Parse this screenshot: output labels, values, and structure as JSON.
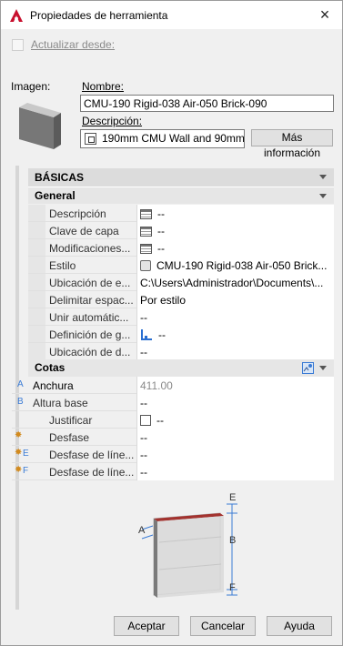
{
  "window": {
    "title": "Propiedades de herramienta"
  },
  "top": {
    "update_from_label": "Actualizar desde:",
    "update_from_checked": false,
    "image_label": "Imagen:",
    "name_label": "Nombre:",
    "name_value": "CMU-190 Rigid-038 Air-050 Brick-090",
    "description_label": "Descripción:",
    "description_value": "190mm CMU Wall and 90mm",
    "more_info_button": "Más información"
  },
  "basicas": {
    "header": "BÁSICAS",
    "general_header": "General",
    "rows": [
      {
        "label": "Descripción",
        "value": "--"
      },
      {
        "label": "Clave de capa",
        "value": "--"
      },
      {
        "label": "Modificaciones...",
        "value": "--"
      },
      {
        "label": "Estilo",
        "value": "CMU-190 Rigid-038 Air-050 Brick..."
      },
      {
        "label": "Ubicación de e...",
        "value": "C:\\Users\\Administrador\\Documents\\..."
      },
      {
        "label": "Delimitar espac...",
        "value": "Por estilo"
      },
      {
        "label": "Unir automátic...",
        "value": "--"
      },
      {
        "label": "Definición de g...",
        "value": "--"
      },
      {
        "label": "Ubicación de d...",
        "value": "--"
      }
    ]
  },
  "cotas": {
    "header": "Cotas",
    "rows": [
      {
        "letter": "A",
        "label": "Anchura",
        "value": "411.00"
      },
      {
        "letter": "B",
        "label": "Altura base",
        "value": "--"
      },
      {
        "letter": "",
        "label": "Justificar",
        "value": "--"
      },
      {
        "letter": "",
        "label": "Desfase",
        "value": "--"
      },
      {
        "letter": "E",
        "label": "Desfase de líne...",
        "value": "--"
      },
      {
        "letter": "F",
        "label": "Desfase de líne...",
        "value": "--"
      }
    ]
  },
  "diagram_labels": {
    "a": "A",
    "b": "B",
    "e": "E",
    "f": "F"
  },
  "buttons": {
    "ok": "Aceptar",
    "cancel": "Cancelar",
    "help": "Ayuda"
  },
  "colors": {
    "accent_red": "#c8102e",
    "brick_top": "#a3332f",
    "link_blue": "#3a7bd5"
  }
}
